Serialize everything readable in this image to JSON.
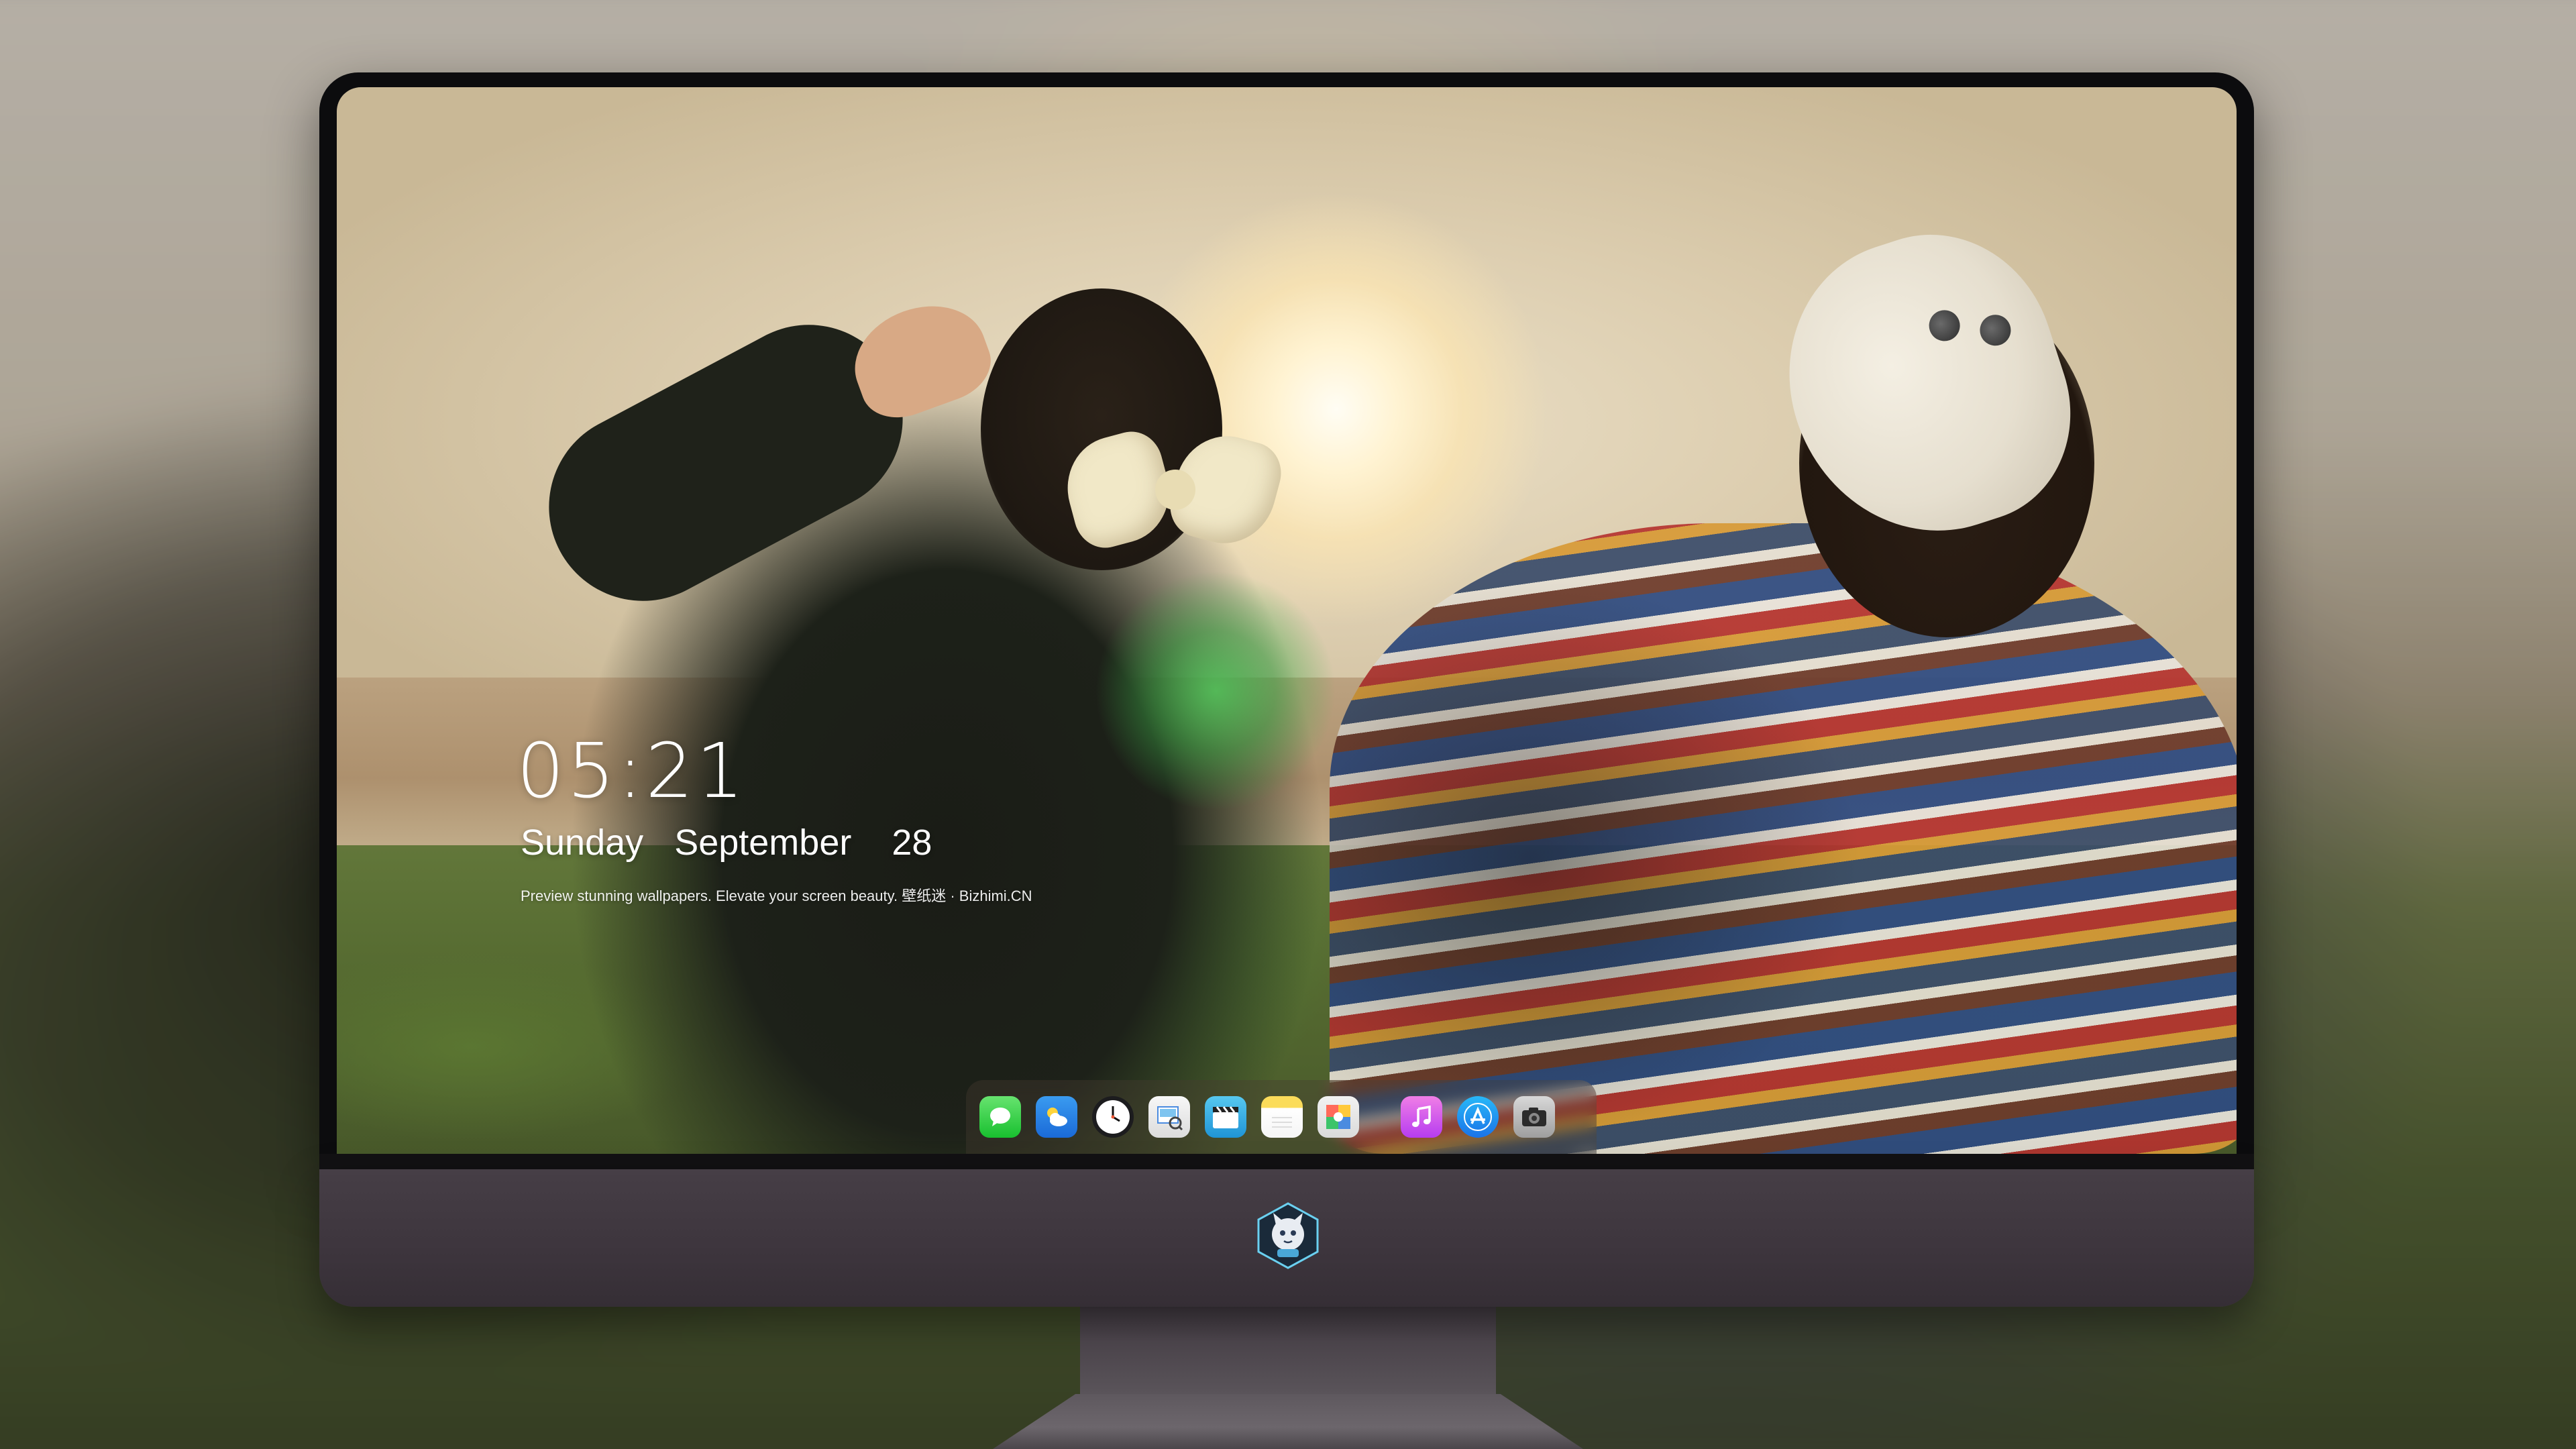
{
  "lock_screen": {
    "time": "05:21",
    "date": {
      "weekday": "Sunday",
      "month": "September",
      "day": "28"
    },
    "tagline": "Preview stunning wallpapers. Elevate your screen beauty. 壁纸迷 · Bizhimi.CN"
  },
  "dock": {
    "items": [
      {
        "name": "messages",
        "icon": "messages-icon"
      },
      {
        "name": "weather",
        "icon": "weather-icon"
      },
      {
        "name": "clock",
        "icon": "clock-icon"
      },
      {
        "name": "preview",
        "icon": "preview-icon"
      },
      {
        "name": "clips",
        "icon": "clapperboard-icon"
      },
      {
        "name": "notes",
        "icon": "notes-icon"
      },
      {
        "name": "photo-booth",
        "icon": "photos-icon"
      },
      {
        "name": "music",
        "icon": "music-note-icon"
      },
      {
        "name": "app-store",
        "icon": "app-store-icon"
      },
      {
        "name": "camera",
        "icon": "camera-icon"
      }
    ]
  },
  "monitor": {
    "logo_icon": "mascot-logo-icon"
  },
  "colors": {
    "bezel": "#0c0c0e",
    "chin": "#3d353d",
    "dock_bg": "rgba(70,60,50,0.38)",
    "text": "#ffffff"
  }
}
